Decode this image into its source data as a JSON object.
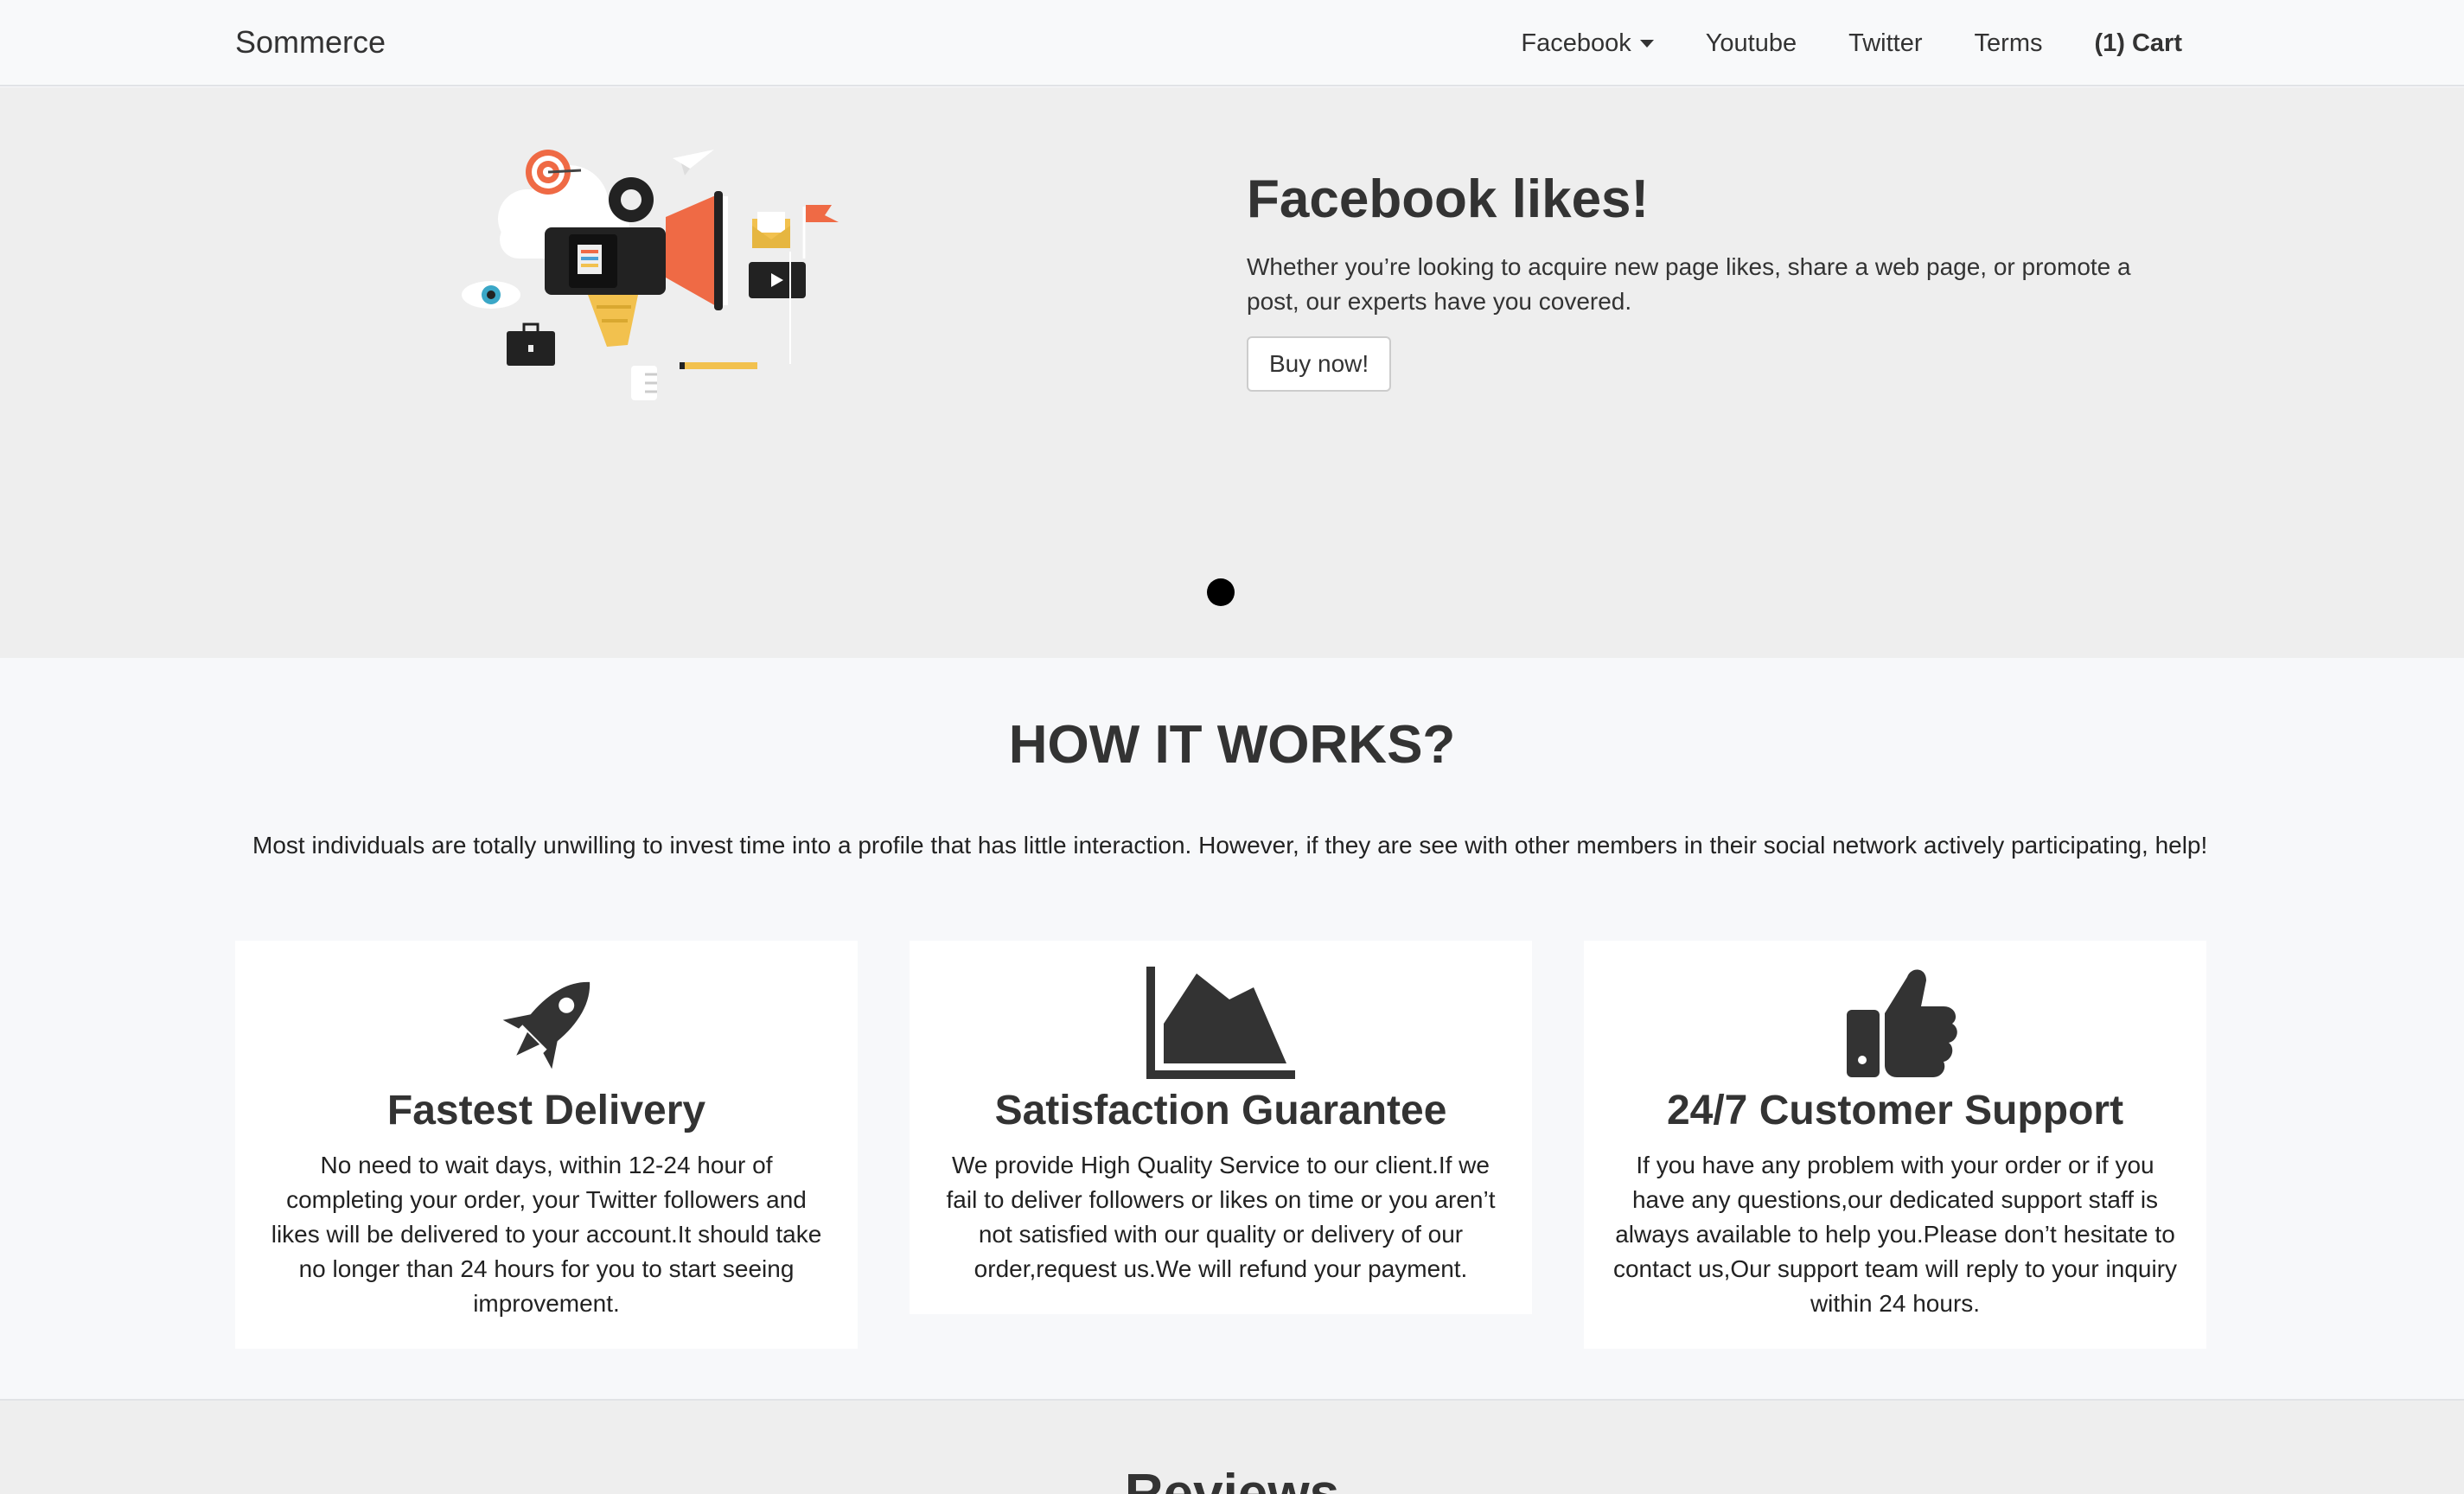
{
  "navbar": {
    "brand": "Sommerce",
    "items": [
      {
        "label": "Facebook",
        "dropdown": true
      },
      {
        "label": "Youtube"
      },
      {
        "label": "Twitter"
      },
      {
        "label": "Terms"
      },
      {
        "label": "(1) Cart"
      }
    ]
  },
  "hero": {
    "title": "Facebook likes!",
    "description": "Whether you’re looking to acquire new page likes, share a web page, or promote a post, our experts have you covered.",
    "button_label": "Buy now!",
    "illustration": "megaphone-marketing-illustration",
    "slides_count": 1,
    "active_slide": 1
  },
  "how_it_works": {
    "title": "HOW IT WORKS?",
    "intro": "Most individuals are totally unwilling to invest time into a profile that has little interaction. However, if they are see with other members in their social network actively participating, help!",
    "features": [
      {
        "icon": "rocket-icon",
        "title": "Fastest Delivery",
        "text": "No need to wait days, within 12-24 hour of completing your order, your Twitter followers and likes will be delivered to your account.It should take no longer than 24 hours for you to start seeing improvement."
      },
      {
        "icon": "area-chart-icon",
        "title": "Satisfaction Guarantee",
        "text": "We provide High Quality Service to our client.If we fail to deliver followers or likes on time or you aren’t not satisfied with our quality or delivery of our order,request us.We will refund your payment."
      },
      {
        "icon": "thumbs-up-icon",
        "title": "24/7 Customer Support",
        "text": "If you have any problem with your order or if you have any questions,our dedicated support staff is always available to help you.Please don’t hesitate to contact us,Our support team will reply to your inquiry within 24 hours."
      }
    ]
  },
  "reviews": {
    "title": "Reviews"
  },
  "colors": {
    "navbar_bg": "#f8f9fa",
    "hero_bg": "#eeeeee",
    "page_bg": "#f7f8fa",
    "accent_orange": "#ef6a45",
    "text_dark": "#333333"
  }
}
